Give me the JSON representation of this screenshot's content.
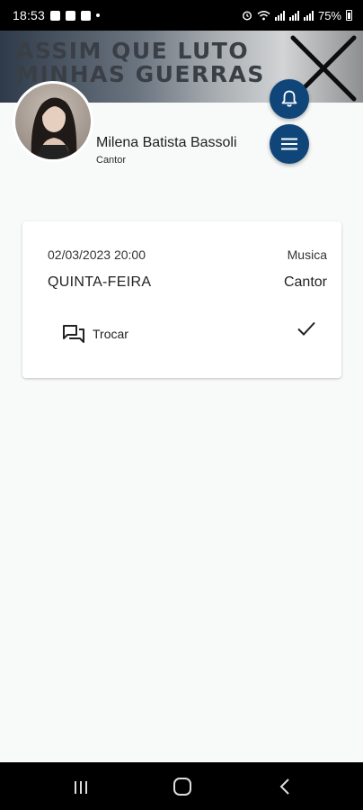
{
  "status_bar": {
    "time": "18:53",
    "battery": "75%"
  },
  "banner": {
    "line1": "ASSIM QUE LUTO",
    "line2": "MINHAS GUERRAS"
  },
  "profile": {
    "name": "Milena Batista Bassoli",
    "role": "Cantor"
  },
  "schedule_card": {
    "date_time": "02/03/2023 20:00",
    "category": "Musica",
    "weekday": "QUINTA-FEIRA",
    "role": "Cantor",
    "swap_label": "Trocar"
  },
  "icons": {
    "notifications": "bell-icon",
    "menu": "menu-icon",
    "swap": "chat-icon",
    "confirmed": "check-icon"
  },
  "colors": {
    "fab_background": "#10457a",
    "page_background": "#f8f9f9"
  }
}
